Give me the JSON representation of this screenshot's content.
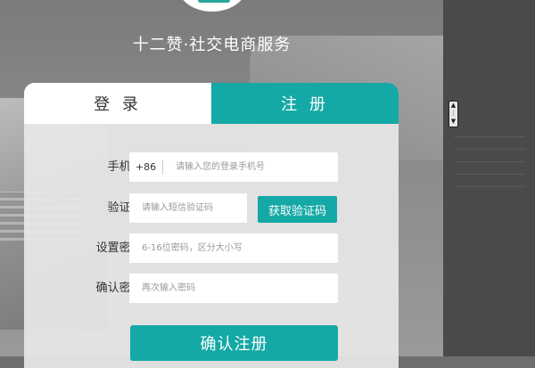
{
  "brand": {
    "title": "十二赞·社交电商服务"
  },
  "tabs": {
    "login": "登 录",
    "register": "注 册"
  },
  "form": {
    "phone": {
      "label": "手机号:",
      "prefix": "+86",
      "placeholder": "请输入您的登录手机号",
      "value": ""
    },
    "code": {
      "label": "验证码:",
      "placeholder": "请输入短信验证码",
      "value": "",
      "button": "获取验证码"
    },
    "password": {
      "label": "设置密码:",
      "placeholder": "6-16位密码，区分大小写",
      "value": ""
    },
    "confirm": {
      "label": "确认密码:",
      "placeholder": "再次输入密码",
      "value": ""
    },
    "submit": "确认注册"
  },
  "colors": {
    "accent": "#14a9a6"
  },
  "icons": {
    "logo": "logo-icon",
    "resize": "resize-handle-icon"
  }
}
